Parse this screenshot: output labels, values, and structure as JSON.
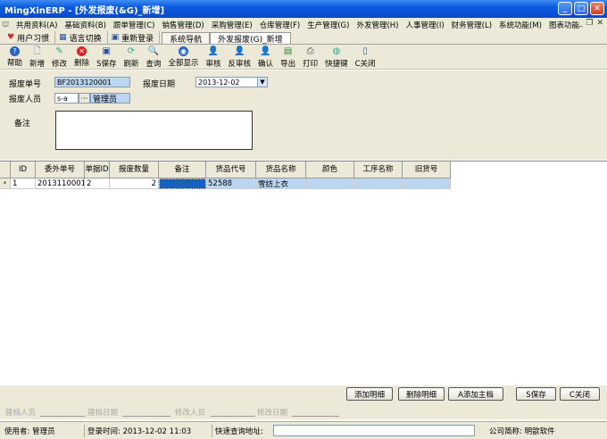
{
  "window": {
    "title": "MingXinERP - [外发报废(&G)_新增]"
  },
  "menu": {
    "items": [
      "共用资料(A)",
      "基础资料(B)",
      "跟单管理(C)",
      "销售管理(D)",
      "采购管理(E)",
      "仓库管理(F)",
      "生产管理(G)",
      "外发管理(H)",
      "人事管理(I)",
      "财务管理(L)",
      "系统功能(M)",
      "图表功能"
    ]
  },
  "quicktabs": {
    "user_habit": "用户习惯",
    "language": "语言切换",
    "relogin": "重新登录",
    "nav": "系统导航",
    "active": "外发报废(G)_新增"
  },
  "toolbar": {
    "help": "帮助",
    "add": "新增",
    "edit": "修改",
    "delete": "删除",
    "save": "S保存",
    "refresh": "刷新",
    "query": "查询",
    "show_all": "全部显示",
    "audit": "审核",
    "unaudit": "反审核",
    "confirm": "确认",
    "export": "导出",
    "print": "打印",
    "shortcut": "快捷键",
    "close": "C关闭"
  },
  "form": {
    "doc_no_label": "报废单号",
    "doc_no": "BF2013120001",
    "date_label": "报废日期",
    "date": "2013-12-02",
    "person_label": "报废人员",
    "person_code": "s-a",
    "person_name": "管理员",
    "remark_label": "备注",
    "ellipsis": "···"
  },
  "grid": {
    "headers": [
      "ID",
      "委外单号",
      "单据ID",
      "报废数量",
      "备注",
      "货品代号",
      "货品名称",
      "颜色",
      "工序名称",
      "旧货号"
    ],
    "row_marker": "*",
    "rows": [
      [
        "1",
        "2013110001",
        "2",
        "2",
        "",
        "52588",
        "雪纺上衣",
        "",
        "",
        ""
      ]
    ]
  },
  "buttons": {
    "add_detail": "添加明细",
    "del_detail": "删除明细",
    "add_master": "A添加主档",
    "save": "S保存",
    "close": "C关闭"
  },
  "audit": {
    "creator": "建档人员",
    "create_date": "建档日期",
    "modifier": "修改人员",
    "modify_date": "修改日期"
  },
  "status": {
    "user": "使用者: 管理员",
    "login_time": "登录时间: 2013-12-02 11:03",
    "quick_query": "快速查询地址:",
    "company": "公司简称: 明歆软件"
  }
}
